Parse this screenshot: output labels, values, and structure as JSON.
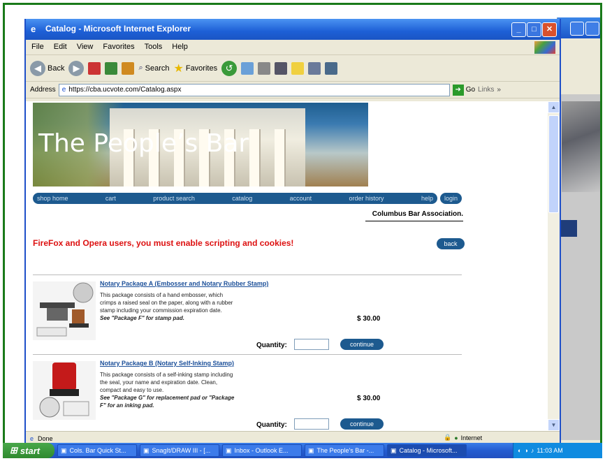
{
  "window": {
    "title": "Catalog - Microsoft Internet Explorer"
  },
  "menu": [
    "File",
    "Edit",
    "View",
    "Favorites",
    "Tools",
    "Help"
  ],
  "toolbar": {
    "back": "Back",
    "search": "Search",
    "favorites": "Favorites"
  },
  "address": {
    "label": "Address",
    "url": "https://cba.ucvote.com/Catalog.aspx",
    "go": "Go",
    "links": "Links"
  },
  "page": {
    "banner_title": "The People’s Bar",
    "nav": [
      "shop home",
      "cart",
      "product search",
      "catalog",
      "account",
      "order history",
      "help"
    ],
    "login": "login",
    "association": "Columbus Bar Association.",
    "warning": "FireFox and Opera users, you must enable scripting and cookies!",
    "back_button": "back",
    "products": [
      {
        "title": "Notary Package A (Embosser and Notary Rubber Stamp)",
        "desc": "This package consists of a hand embosser, which crimps a raised seal on the paper, along with a rubber stamp including your commission expiration date.",
        "note": "See \"Package F\" for stamp pad.",
        "price": "$ 30.00",
        "qty_label": "Quantity:",
        "button": "continue"
      },
      {
        "title": "Notary Package B (Notary Self-Inking Stamp)",
        "desc": "This package consists of a self-inking stamp including the seal, your name and expiration date. Clean, compact and easy to use.",
        "note": "See \"Package G\" for replacement pad or \"Package F\" for an inking pad.",
        "price": "$ 30.00",
        "qty_label": "Quantity:",
        "button": "continue"
      }
    ]
  },
  "status": {
    "left": "Done",
    "zone": "Internet"
  },
  "taskbar": {
    "start": "start",
    "tasks": [
      "Cols. Bar Quick St...",
      "SnagIt/DRAW III - [...",
      "Inbox - Outlook E...",
      "The People's Bar -...",
      "Catalog - Microsoft..."
    ],
    "clock": "11:03 AM"
  },
  "colors": {
    "nav_blue": "#1d5a8f",
    "warning_red": "#dd1111",
    "title_link": "#1b4f99",
    "frame_green": "#1a7a1a"
  }
}
